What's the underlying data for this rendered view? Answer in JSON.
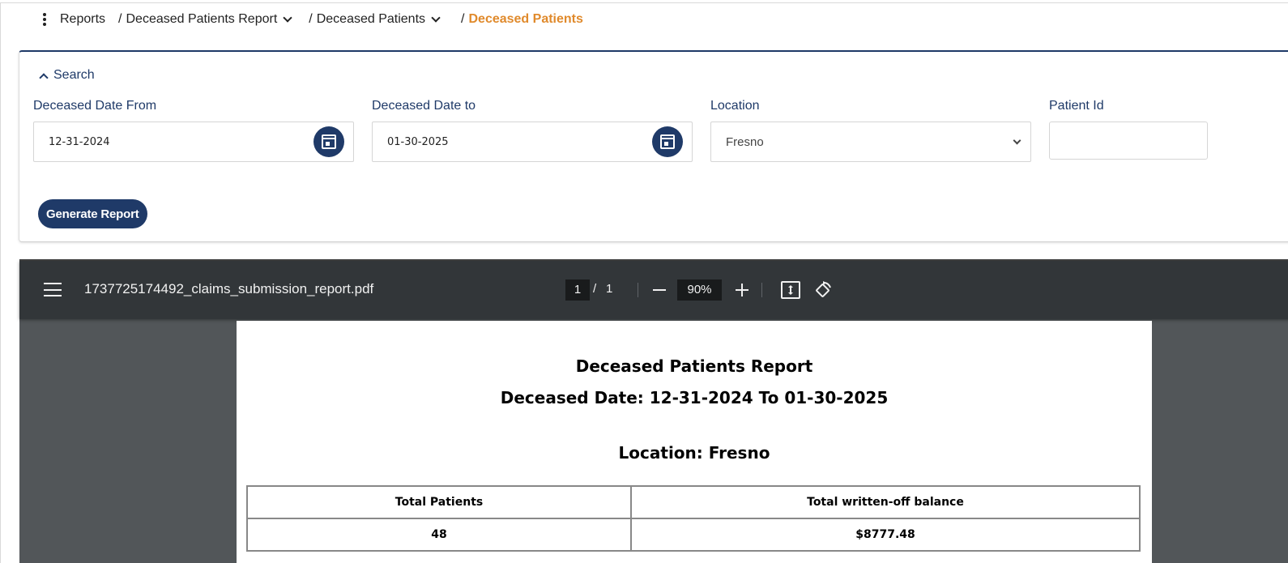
{
  "breadcrumb": {
    "items": [
      {
        "label": "Reports"
      },
      {
        "sep": "/",
        "label": "Deceased Patients Report"
      },
      {
        "sep": "/",
        "label": "Deceased Patients"
      },
      {
        "sep": "/",
        "label": "Deceased Patients"
      }
    ]
  },
  "search": {
    "toggle_label": "Search",
    "date_from": {
      "label": "Deceased Date From",
      "value": "12-31-2024"
    },
    "date_to": {
      "label": "Deceased Date to",
      "value": "01-30-2025"
    },
    "location": {
      "label": "Location",
      "value": "Fresno"
    },
    "patient_id": {
      "label": "Patient Id",
      "value": ""
    },
    "generate_label": "Generate Report"
  },
  "viewer": {
    "file_name": "1737725174492_claims_submission_report.pdf",
    "page_current": "1",
    "page_sep": "/",
    "page_total": "1",
    "zoom": "90%"
  },
  "report": {
    "title": "Deceased Patients Report",
    "date_range": "Deceased Date: 12-31-2024 To 01-30-2025",
    "location": "Location: Fresno",
    "table": {
      "headers": [
        "Total Patients",
        "Total written-off balance"
      ],
      "values": [
        "48",
        "$8777.48"
      ]
    }
  },
  "colors": {
    "primary": "#1f3a68",
    "active_crumb": "#e08a2c",
    "viewer_toolbar": "#323639",
    "viewer_bg": "#525659"
  }
}
